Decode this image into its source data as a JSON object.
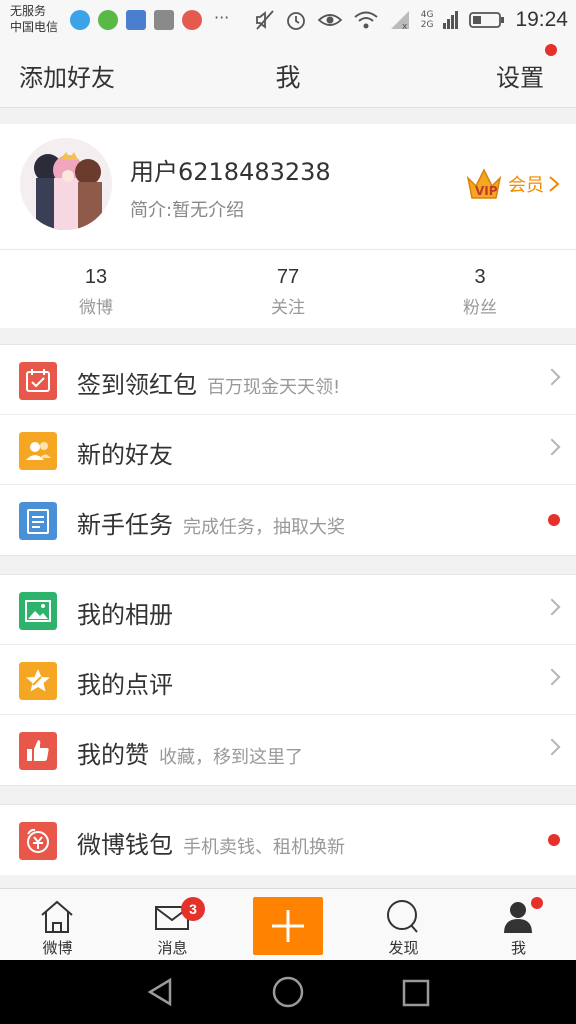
{
  "status_bar": {
    "carrier_line1": "无服务",
    "carrier_line2": "中国电信",
    "more_dots": "···",
    "network_label": "4G",
    "network_label2": "2G",
    "time": "19:24"
  },
  "header": {
    "left_label": "添加好友",
    "title": "我",
    "right_label": "设置"
  },
  "profile": {
    "username": "用户6218483238",
    "bio": "简介:暂无介绍",
    "vip_label": "会员"
  },
  "stats": [
    {
      "value": "13",
      "label": "微博"
    },
    {
      "value": "77",
      "label": "关注"
    },
    {
      "value": "3",
      "label": "粉丝"
    }
  ],
  "menu": {
    "checkin": {
      "title": "签到领红包",
      "subtitle": "百万现金天天领!"
    },
    "new_friends": {
      "title": "新的好友",
      "subtitle": ""
    },
    "newbie_tasks": {
      "title": "新手任务",
      "subtitle": "完成任务，抽取大奖"
    },
    "album": {
      "title": "我的相册",
      "subtitle": ""
    },
    "reviews": {
      "title": "我的点评",
      "subtitle": ""
    },
    "likes": {
      "title": "我的赞",
      "subtitle": "收藏，移到这里了"
    },
    "wallet": {
      "title": "微博钱包",
      "subtitle": "手机卖钱、租机换新"
    }
  },
  "tabbar": {
    "home": "微博",
    "messages": "消息",
    "messages_badge": "3",
    "discover": "发现",
    "me": "我"
  },
  "colors": {
    "accent": "#ff8200",
    "badge_red": "#e4312b",
    "checkin_icon": "#e8584a",
    "friends_icon": "#f5a623",
    "tasks_icon": "#4a90d9",
    "album_icon": "#2db36b",
    "reviews_icon": "#f5a623",
    "likes_icon": "#e8584a",
    "wallet_icon": "#e8584a"
  }
}
